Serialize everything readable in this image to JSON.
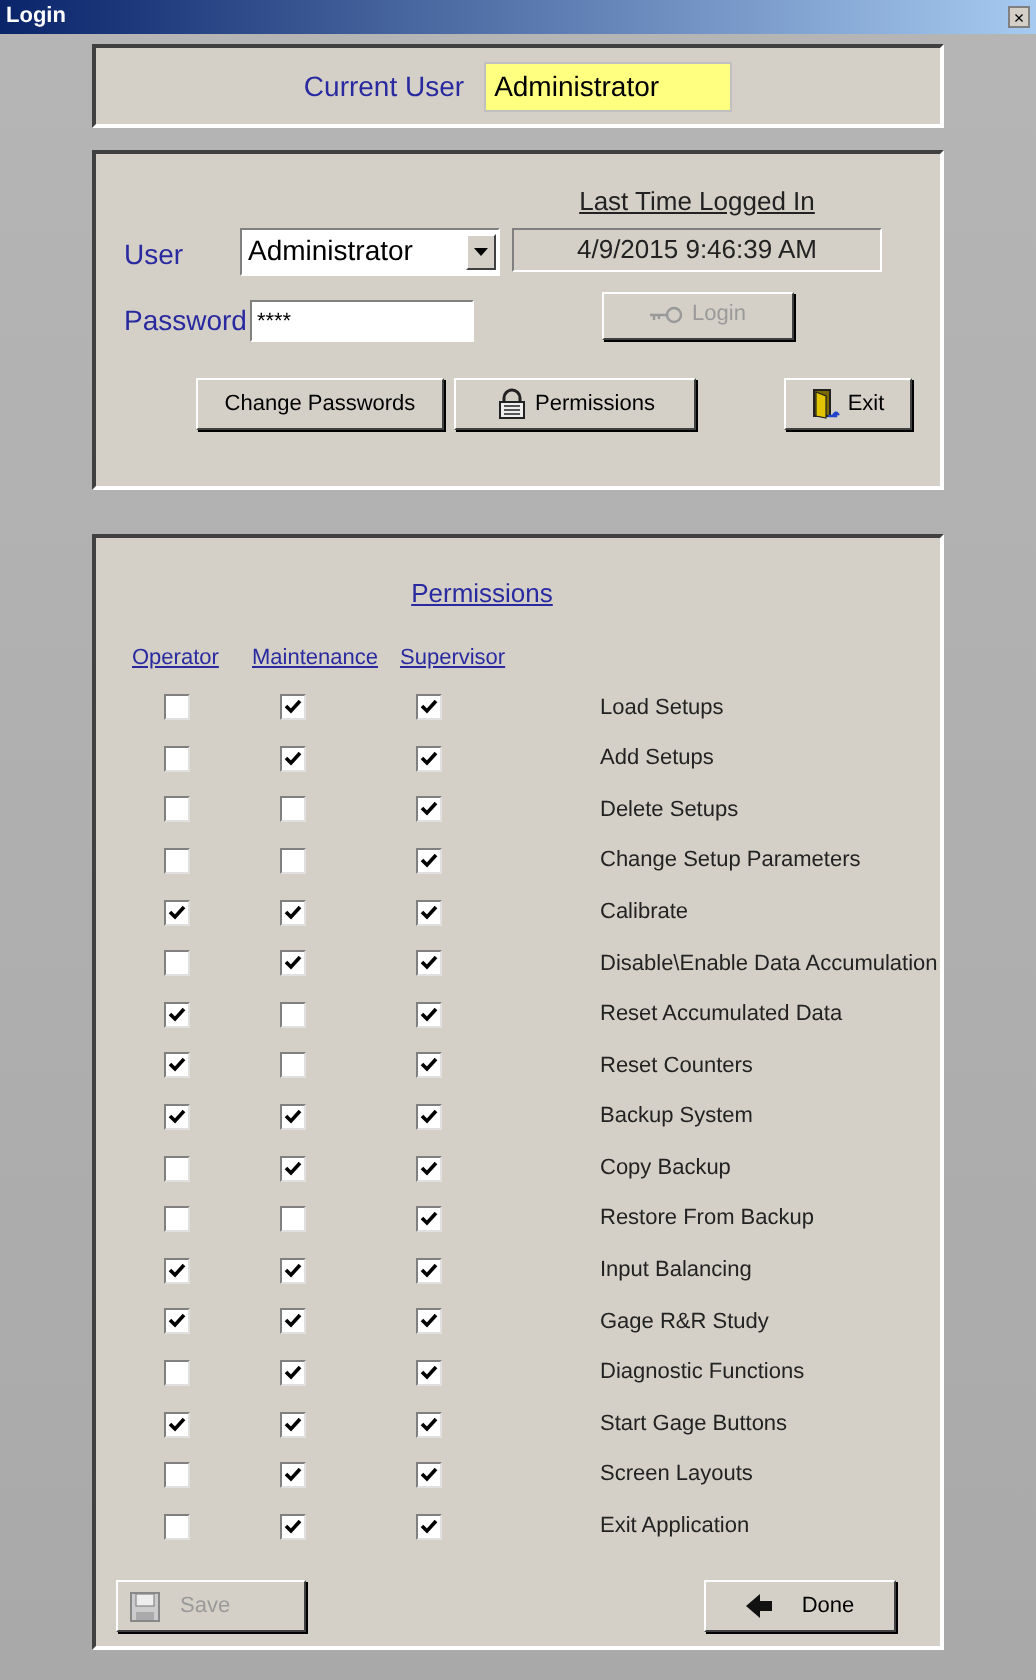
{
  "window": {
    "title": "Login",
    "close": "×"
  },
  "current_user": {
    "label": "Current User",
    "value": "Administrator"
  },
  "login": {
    "user_label": "User",
    "user_value": "Administrator",
    "last_login_label": "Last Time Logged In",
    "last_login_value": "4/9/2015 9:46:39 AM",
    "password_label": "Password",
    "password_value": "****",
    "login_button": {
      "label": "Login",
      "disabled": true
    },
    "buttons": [
      {
        "kind": "text",
        "label": "Change Passwords"
      },
      {
        "kind": "lock",
        "label": "Permissions"
      },
      {
        "kind": "exit",
        "label": "Exit"
      }
    ]
  },
  "permissions": {
    "title": "Permissions",
    "columns": [
      "Operator",
      "Maintenance",
      "Supervisor"
    ],
    "rows": [
      {
        "label": "Load Setups",
        "checks": [
          false,
          true,
          true
        ]
      },
      {
        "label": "Add Setups",
        "checks": [
          false,
          true,
          true
        ]
      },
      {
        "label": "Delete Setups",
        "checks": [
          false,
          false,
          true
        ]
      },
      {
        "label": "Change Setup Parameters",
        "checks": [
          false,
          false,
          true
        ]
      },
      {
        "label": "Calibrate",
        "checks": [
          true,
          true,
          true
        ]
      },
      {
        "label": "Disable\\Enable Data Accumulation",
        "checks": [
          false,
          true,
          true
        ]
      },
      {
        "label": "Reset Accumulated Data",
        "checks": [
          true,
          false,
          true
        ]
      },
      {
        "label": "Reset Counters",
        "checks": [
          true,
          false,
          true
        ]
      },
      {
        "label": "Backup System",
        "checks": [
          true,
          true,
          true
        ]
      },
      {
        "label": "Copy Backup",
        "checks": [
          false,
          true,
          true
        ]
      },
      {
        "label": "Restore From Backup",
        "checks": [
          false,
          false,
          true
        ]
      },
      {
        "label": "Input Balancing",
        "checks": [
          true,
          true,
          true
        ]
      },
      {
        "label": "Gage R&R Study",
        "checks": [
          true,
          true,
          true
        ]
      },
      {
        "label": "Diagnostic Functions",
        "checks": [
          false,
          true,
          true
        ]
      },
      {
        "label": "Start Gage Buttons",
        "checks": [
          true,
          true,
          true
        ]
      },
      {
        "label": "Screen Layouts",
        "checks": [
          false,
          true,
          true
        ]
      },
      {
        "label": "Exit Application",
        "checks": [
          false,
          true,
          true
        ]
      }
    ],
    "save_button": {
      "label": "Save",
      "disabled": true
    },
    "done_button": {
      "label": "Done",
      "disabled": false
    }
  }
}
